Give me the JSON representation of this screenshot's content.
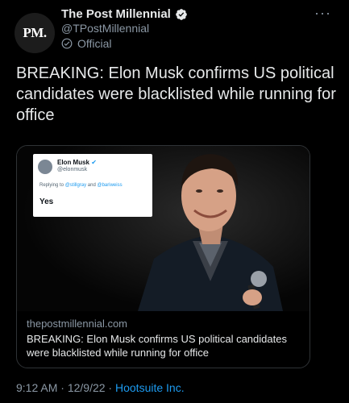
{
  "author": {
    "avatar_text": "PM.",
    "display_name": "The Post Millennial",
    "handle": "@TPostMillennial",
    "badge_label": "Official"
  },
  "tweet": {
    "text": "BREAKING: Elon Musk confirms US political candidates were blacklisted while running for office"
  },
  "card": {
    "embedded_tweet": {
      "name": "Elon Musk",
      "handle": "@elonmusk",
      "replying_prefix": "Replying to ",
      "mention_1": "@stillgray",
      "replying_and": " and ",
      "mention_2": "@bariweiss",
      "text": "Yes"
    },
    "domain": "thepostmillennial.com",
    "title": "BREAKING: Elon Musk confirms US political candidates were blacklisted while running for office"
  },
  "meta": {
    "time": "9:12 AM",
    "separator": " · ",
    "date": "12/9/22",
    "separator2": " · ",
    "source": "Hootsuite Inc."
  },
  "colors": {
    "background": "#000000",
    "text": "#e7e9ea",
    "muted": "#8b98a5",
    "link": "#1d9bf0",
    "verified": "#1d9bf0"
  }
}
